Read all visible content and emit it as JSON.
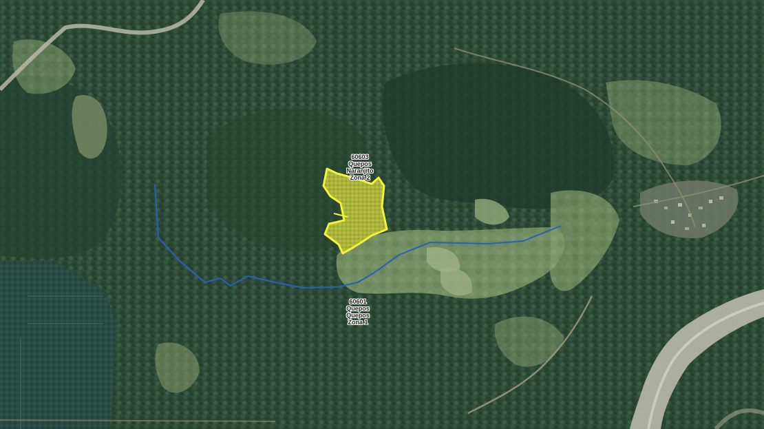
{
  "map": {
    "colors": {
      "forest": "#2d4b38",
      "forest_dark": "#1f3a2c",
      "pasture": "#7f9a6a",
      "pasture_light": "#a2b48a",
      "river_bed": "#b9b9ad",
      "parcel_fill": "#c8d23c",
      "parcel_outline": "#f4f23a",
      "boundary_line": "#2a5fb8"
    },
    "district_labels": [
      {
        "code": "60603",
        "canton": "Quepos",
        "district": "Naranjito",
        "zone": "Zona 2"
      },
      {
        "code": "60601",
        "canton": "Quepos",
        "district": "Quepos",
        "zone": "Zona 1"
      }
    ],
    "highlighted_parcel": {
      "shape": "selected-property"
    }
  }
}
